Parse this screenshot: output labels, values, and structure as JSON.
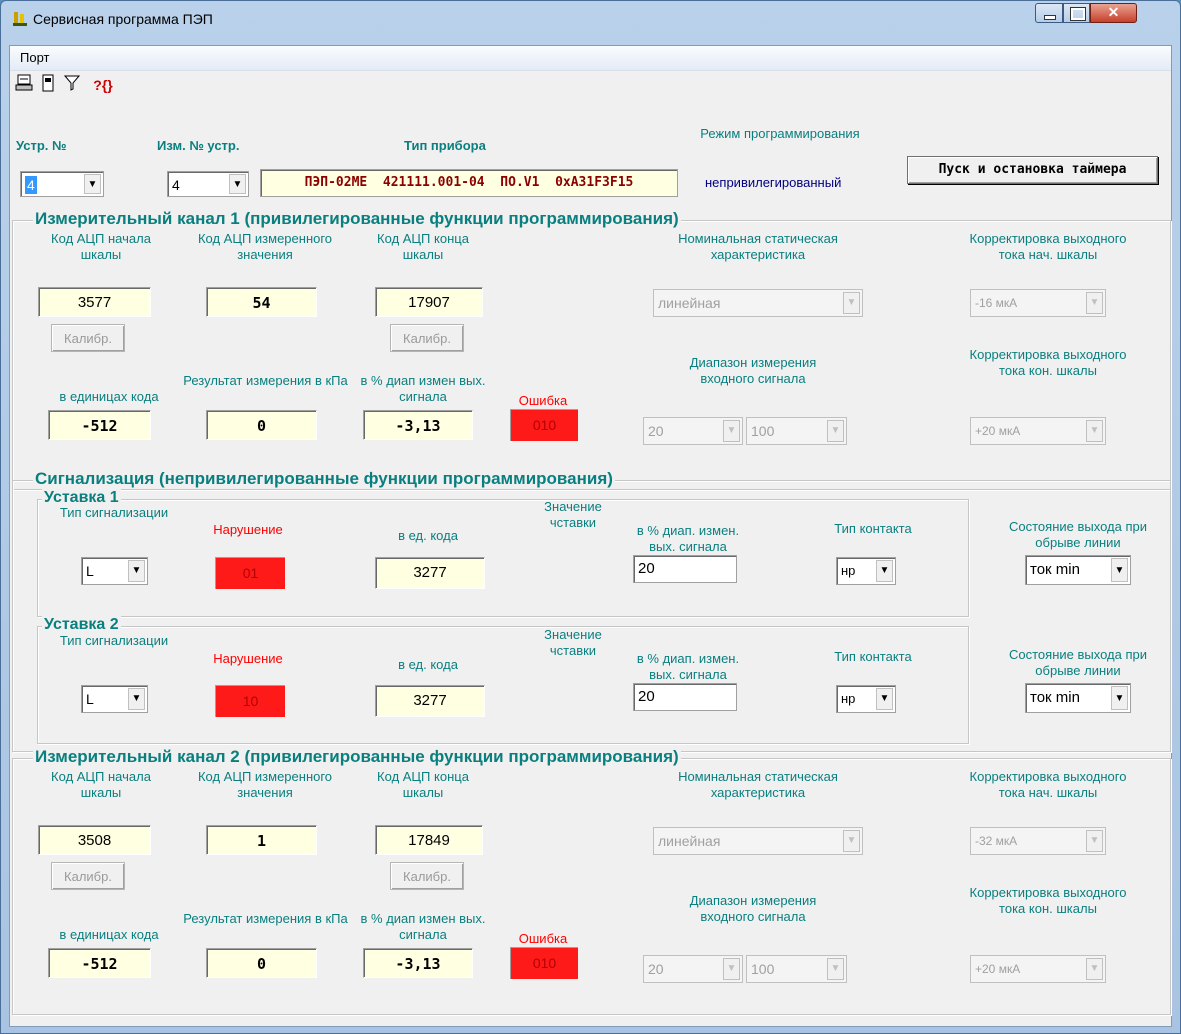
{
  "window": {
    "title": "Сервисная программа ПЭП",
    "icon": "app-logo-icon",
    "controls": [
      "minimize",
      "maximize",
      "close"
    ]
  },
  "menu": {
    "port": "Порт"
  },
  "toolbar": {
    "icons": [
      "computer-icon",
      "device-icon",
      "filter-icon",
      "help-icon"
    ],
    "help_glyph": "?{}"
  },
  "header": {
    "dev_no_label": "Устр. №",
    "dev_no_value": "4",
    "change_no_label": "Изм. № устр.",
    "change_no_value": "4",
    "device_type_label": "Тип прибора",
    "device_type_value": "ПЭП-02МЕ  421111.001-04  ПО.V1  0xA31F3F15",
    "mode_label": "Режим программирования",
    "mode_value": "непривилегированный",
    "timer_button": "Пуск и остановка таймера"
  },
  "channel1": {
    "title": "Измерительный канал  1 (привилегированные функции программирования)",
    "adc_start_label": "Код АЦП начала шкалы",
    "adc_start_value": "3577",
    "adc_measured_label": "Код АЦП измеренного значения",
    "adc_measured_value": "54",
    "adc_end_label": "Код АЦП конца шкалы",
    "adc_end_value": "17907",
    "calib_label": "Калибр.",
    "units_code_label": "в единицах кода",
    "units_code_value": "-512",
    "result_label": "Результат измерения в кПа",
    "result_value": "0",
    "percent_label": "в % диап измен вых. сигнала",
    "percent_value": "-3,13",
    "error_label": "Ошибка",
    "error_value": "010",
    "nsc_label": "Номинальная статическая характеристика",
    "nsc_value": "линейная",
    "corr_start_label": "Корректировка выходного тока нач. шкалы",
    "corr_start_value": "-16 мкА",
    "range_label": "Диапазон измерения входного сигнала",
    "range_from": "20",
    "range_to": "100",
    "corr_end_label": "Корректировка выходного тока кон. шкалы",
    "corr_end_value": "+20 мкА"
  },
  "signal": {
    "title": "Сигнализация (непривилегированные функции программирования)",
    "setpoints": [
      {
        "title": "Уставка 1",
        "type_label": "Тип сигнализации",
        "type_value": "L",
        "violation_label": "Нарушение",
        "violation_value": "01",
        "code_label": "в ед. кода",
        "code_value": "3277",
        "setpoint_label": "Значение чставки",
        "percent_label": "в % диап. измен. вых. сигнала",
        "percent_value": "20",
        "contact_label": "Тип контакта",
        "contact_value": "нр",
        "break_label": "Состояние выхода при обрыве линии",
        "break_value": "ток min"
      },
      {
        "title": "Уставка 2",
        "type_label": "Тип сигнализации",
        "type_value": "L",
        "violation_label": "Нарушение",
        "violation_value": "10",
        "code_label": "в ед. кода",
        "code_value": "3277",
        "setpoint_label": "Значение чставки",
        "percent_label": "в % диап. измен. вых. сигнала",
        "percent_value": "20",
        "contact_label": "Тип контакта",
        "contact_value": "нр",
        "break_label": "Состояние выхода при обрыве линии",
        "break_value": "ток min"
      }
    ]
  },
  "channel2": {
    "title": "Измерительный канал  2 (привилегированные функции программирования)",
    "adc_start_label": "Код АЦП начала шкалы",
    "adc_start_value": "3508",
    "adc_measured_label": "Код АЦП измеренного значения",
    "adc_measured_value": "1",
    "adc_end_label": "Код АЦП конца шкалы",
    "adc_end_value": "17849",
    "calib_label": "Калибр.",
    "units_code_label": "в единицах кода",
    "units_code_value": "-512",
    "result_label": "Результат измерения в кПа",
    "result_value": "0",
    "percent_label": "в % диап измен вых. сигнала",
    "percent_value": "-3,13",
    "error_label": "Ошибка",
    "error_value": "010",
    "nsc_label": "Номинальная статическая характеристика",
    "nsc_value": "линейная",
    "corr_start_label": "Корректировка выходного тока нач. шкалы",
    "corr_start_value": "-32 мкА",
    "range_label": "Диапазон измерения входного сигнала",
    "range_from": "20",
    "range_to": "100",
    "corr_end_label": "Корректировка выходного тока кон. шкалы",
    "corr_end_value": "+20 мкА"
  }
}
